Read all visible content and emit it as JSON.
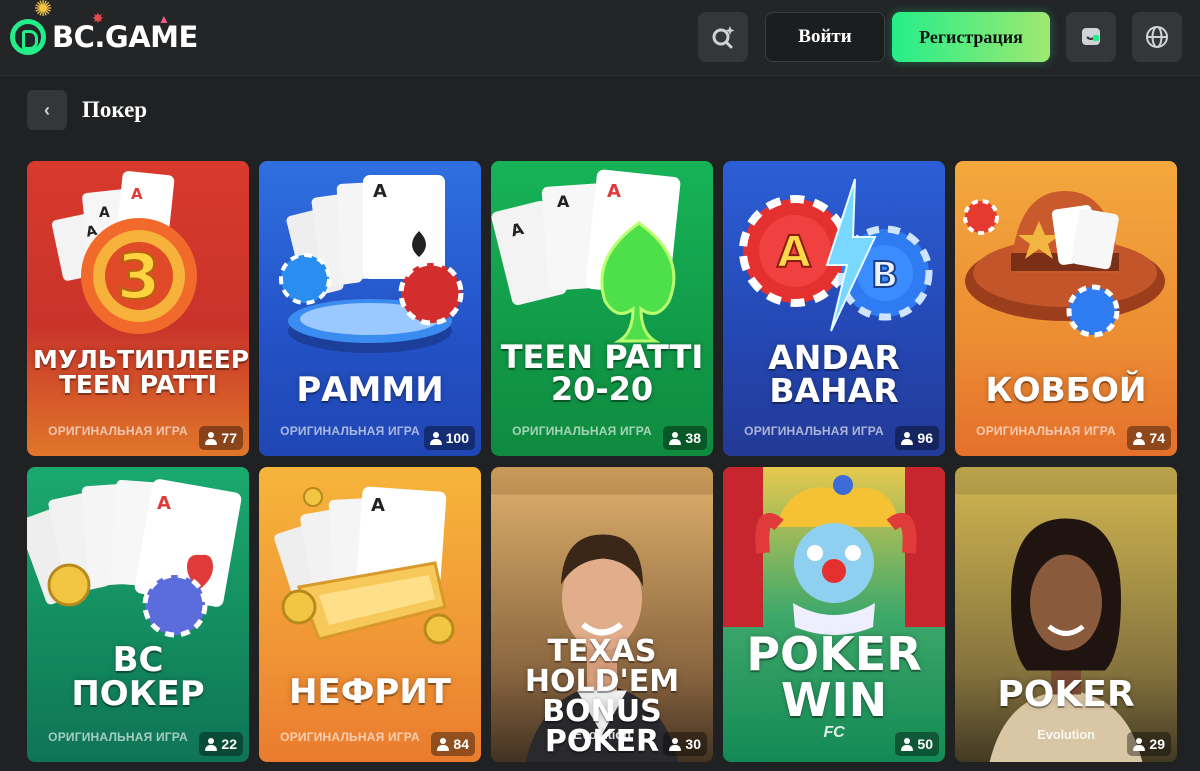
{
  "header": {
    "logo_text": "BC.GAME",
    "search_icon": "search-sparkle-icon",
    "login_label": "Войти",
    "register_label": "Регистрация",
    "chat_icon": "chat-icon",
    "language_icon": "globe-icon"
  },
  "page": {
    "back_icon": "chevron-left-icon",
    "title": "Покер"
  },
  "colors": {
    "accent": "#24ee89",
    "background": "#1f2123",
    "header": "#232527"
  },
  "games": [
    {
      "title": "МУЛЬТИПЛЕЕР\nTEEN PATTI",
      "provider": "ОРИГИНАЛЬНАЯ ИГРА",
      "players": "77",
      "theme": "red",
      "art": "cards-chip-3"
    },
    {
      "title": "РАММИ",
      "provider": "ОРИГИНАЛЬНАЯ ИГРА",
      "players": "100",
      "theme": "blue",
      "art": "cards-podium"
    },
    {
      "title": "TEEN PATTI\n20-20",
      "provider": "ОРИГИНАЛЬНАЯ ИГРА",
      "players": "38",
      "theme": "green",
      "art": "cards-spade"
    },
    {
      "title": "ANDAR\nBAHAR",
      "provider": "ОРИГИНАЛЬНАЯ ИГРА",
      "players": "96",
      "theme": "navy",
      "art": "chips-a-b"
    },
    {
      "title": "КОВБОЙ",
      "provider": "ОРИГИНАЛЬНАЯ ИГРА",
      "players": "74",
      "theme": "orange",
      "art": "cowboy-hat"
    },
    {
      "title": "BC\nПОКЕР",
      "provider": "ОРИГИНАЛЬНАЯ ИГРА",
      "players": "22",
      "theme": "teal",
      "art": "cards-royal"
    },
    {
      "title": "НЕФРИТ",
      "provider": "ОРИГИНАЛЬНАЯ ИГРА",
      "players": "84",
      "theme": "amber",
      "art": "cards-coins"
    },
    {
      "title": "TEXAS\nHOLD'EM\nBONUS POKER",
      "provider": "Evolution",
      "players": "30",
      "theme": "dealer-man",
      "art": "dealer"
    },
    {
      "title": "POKER\nWIN",
      "provider": "FC",
      "players": "50",
      "theme": "circus",
      "art": "jester"
    },
    {
      "title": "POKER",
      "provider": "Evolution",
      "players": "29",
      "theme": "dealer-woman",
      "art": "dealer"
    }
  ]
}
